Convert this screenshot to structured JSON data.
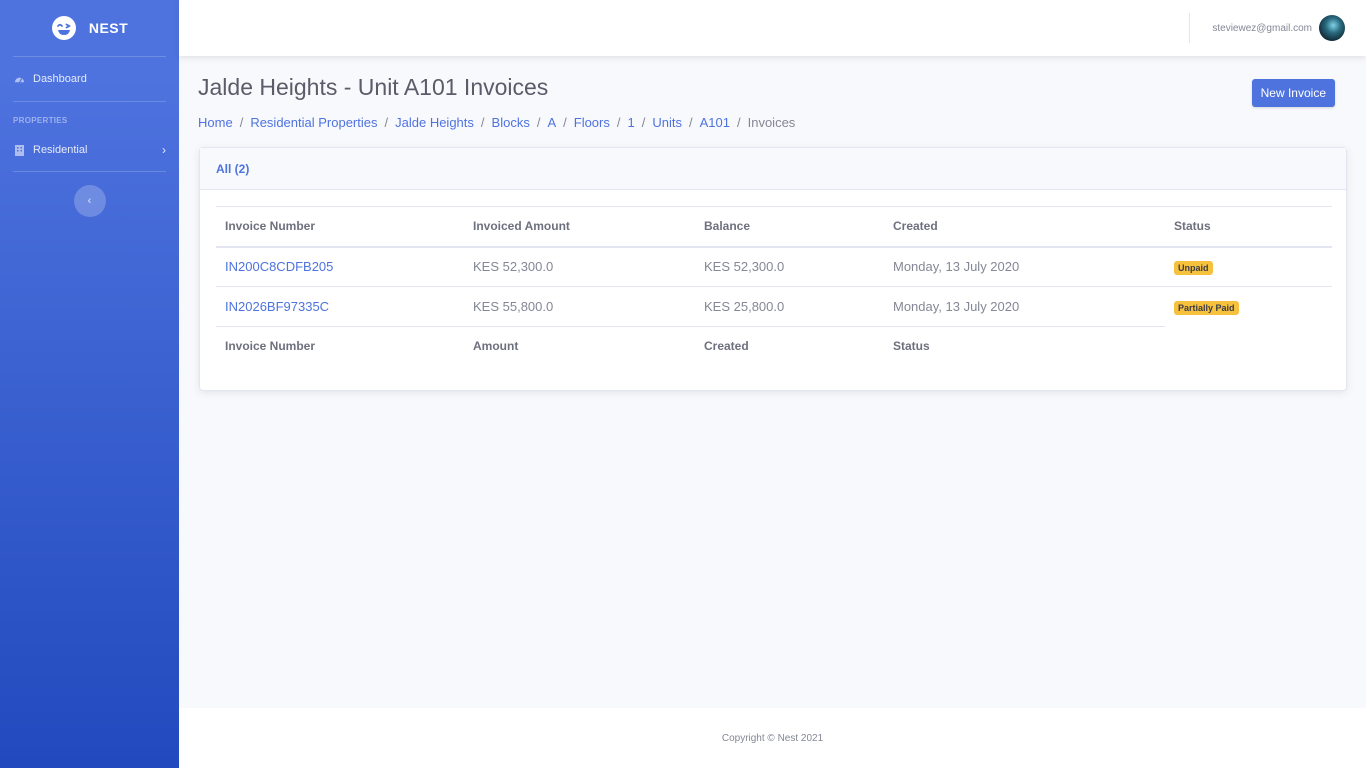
{
  "brand": {
    "name": "NEST"
  },
  "sidebar": {
    "dashboard_label": "Dashboard",
    "section_heading": "PROPERTIES",
    "residential_label": "Residential",
    "toggle_icon": "chevron-left-icon"
  },
  "topbar": {
    "user_email": "steviewez@gmail.com"
  },
  "page": {
    "title": "Jalde Heights - Unit A101 Invoices",
    "new_button": "New Invoice"
  },
  "breadcrumb": [
    {
      "label": "Home"
    },
    {
      "label": "Residential Properties"
    },
    {
      "label": "Jalde Heights"
    },
    {
      "label": "Blocks"
    },
    {
      "label": "A"
    },
    {
      "label": "Floors"
    },
    {
      "label": "1"
    },
    {
      "label": "Units"
    },
    {
      "label": "A101"
    },
    {
      "label": "Invoices"
    }
  ],
  "card": {
    "tab_label": "All (2)"
  },
  "table": {
    "headers": [
      "Invoice Number",
      "Invoiced Amount",
      "Balance",
      "Created",
      "Status"
    ],
    "rows": [
      {
        "number": "IN200C8CDFB205",
        "amount": "KES 52,300.0",
        "balance": "KES 52,300.0",
        "created": "Monday, 13 July 2020",
        "status": "Unpaid"
      },
      {
        "number": "IN2026BF97335C",
        "amount": "KES 55,800.0",
        "balance": "KES 25,800.0",
        "created": "Monday, 13 July 2020",
        "status": "Partially Paid"
      }
    ],
    "footer": [
      "Invoice Number",
      "Amount",
      "Created",
      "Status"
    ]
  },
  "footer": {
    "copyright": "Copyright © Nest 2021"
  },
  "colors": {
    "primary": "#4e73df",
    "warning": "#f6c23e",
    "sidebar_bottom": "#224abe"
  }
}
